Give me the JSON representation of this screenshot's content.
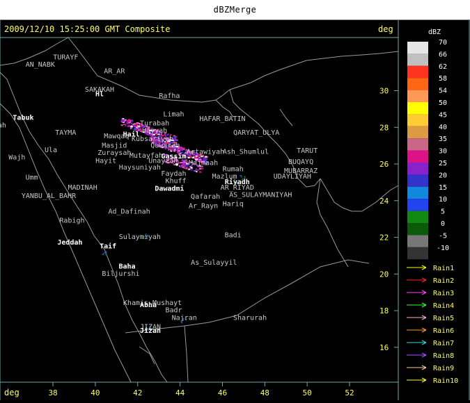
{
  "window": {
    "title": "dBZMerge"
  },
  "header": {
    "timestamp": "2009/12/10 15:25:00 GMT Composite",
    "right_unit": "deg",
    "bottom_unit": "deg"
  },
  "axes": {
    "x_ticks": [
      "38",
      "40",
      "42",
      "44",
      "46",
      "48",
      "50",
      "52"
    ],
    "y_ticks": [
      "30",
      "28",
      "26",
      "24",
      "22",
      "20",
      "18",
      "16"
    ],
    "x_range_deg_lon": [
      35.5,
      54.3
    ],
    "y_range_deg_lat": [
      14.1,
      32.9
    ]
  },
  "colorbar": {
    "title": "dBZ",
    "entries": [
      {
        "label": "70",
        "color": "#e6e6e6"
      },
      {
        "label": "66",
        "color": "#c0c0c0"
      },
      {
        "label": "62",
        "color": "#ff3322"
      },
      {
        "label": "58",
        "color": "#ff6611"
      },
      {
        "label": "54",
        "color": "#ff9955"
      },
      {
        "label": "50",
        "color": "#ffff00"
      },
      {
        "label": "45",
        "color": "#ffcc33"
      },
      {
        "label": "40",
        "color": "#dd9944"
      },
      {
        "label": "35",
        "color": "#cc6688"
      },
      {
        "label": "30",
        "color": "#dd1188"
      },
      {
        "label": "25",
        "color": "#8822cc"
      },
      {
        "label": "20",
        "color": "#3333cc"
      },
      {
        "label": "15",
        "color": "#1188dd"
      },
      {
        "label": "10",
        "color": "#2244ee"
      },
      {
        "label": "5",
        "color": "#118811"
      },
      {
        "label": "0",
        "color": "#0b5a0b"
      },
      {
        "label": "-5",
        "color": "#777777"
      },
      {
        "label": "-10",
        "color": "#333333"
      }
    ]
  },
  "legend": {
    "items": [
      {
        "label": "Rain1",
        "color": "#ffff00"
      },
      {
        "label": "Rain2",
        "color": "#ff2222"
      },
      {
        "label": "Rain3",
        "color": "#ff44ff"
      },
      {
        "label": "Rain4",
        "color": "#33ff33"
      },
      {
        "label": "Rain5",
        "color": "#ffaadd"
      },
      {
        "label": "Rain6",
        "color": "#ff9933"
      },
      {
        "label": "Rain7",
        "color": "#33dddd"
      },
      {
        "label": "Rain8",
        "color": "#aa55ff"
      },
      {
        "label": "Rain9",
        "color": "#ffcc99"
      },
      {
        "label": "Rain10",
        "color": "#ffff33"
      }
    ]
  },
  "places": [
    {
      "name": "TURAYF",
      "lon": 38.6,
      "lat": 31.7
    },
    {
      "name": "AN_NABK",
      "lon": 37.4,
      "lat": 31.3
    },
    {
      "name": "AR_AR",
      "lon": 40.9,
      "lat": 30.95
    },
    {
      "name": "SAKAKAH",
      "lon": 40.2,
      "lat": 29.95
    },
    {
      "name": "Hl",
      "lon": 40.2,
      "lat": 29.7,
      "city": true
    },
    {
      "name": "Rafha",
      "lon": 43.5,
      "lat": 29.6
    },
    {
      "name": "Tabuk",
      "lon": 36.6,
      "lat": 28.4,
      "city": true
    },
    {
      "name": "Sharmah",
      "lon": 35.1,
      "lat": 28.0
    },
    {
      "name": "Limah",
      "lon": 43.7,
      "lat": 28.6
    },
    {
      "name": "HAFAR_BATIN",
      "lon": 46.0,
      "lat": 28.35
    },
    {
      "name": "Turabah",
      "lon": 42.8,
      "lat": 28.1
    },
    {
      "name": "Hayyah",
      "lon": 42.8,
      "lat": 27.7
    },
    {
      "name": "TAYMA",
      "lon": 38.6,
      "lat": 27.6
    },
    {
      "name": "Mawqaq",
      "lon": 41.0,
      "lat": 27.4
    },
    {
      "name": "Hail",
      "lon": 41.7,
      "lat": 27.5,
      "city": true
    },
    {
      "name": "Kubsariyah",
      "lon": 42.7,
      "lat": 27.25
    },
    {
      "name": "QARYAT_ULYA",
      "lon": 47.6,
      "lat": 27.6
    },
    {
      "name": "Masjid",
      "lon": 40.9,
      "lat": 26.9
    },
    {
      "name": "Quwarah",
      "lon": 43.3,
      "lat": 26.9
    },
    {
      "name": "Ula",
      "lon": 37.9,
      "lat": 26.65
    },
    {
      "name": "Artawiyah",
      "lon": 45.2,
      "lat": 26.55
    },
    {
      "name": "Ash_Shumlul",
      "lon": 47.1,
      "lat": 26.55
    },
    {
      "name": "TARUT",
      "lon": 50.0,
      "lat": 26.6
    },
    {
      "name": "Wajh",
      "lon": 36.3,
      "lat": 26.25
    },
    {
      "name": "Zuraysah",
      "lon": 40.9,
      "lat": 26.5
    },
    {
      "name": "Mutayfah",
      "lon": 42.4,
      "lat": 26.35
    },
    {
      "name": "Gassim",
      "lon": 43.7,
      "lat": 26.3,
      "city": true
    },
    {
      "name": "Unayzah",
      "lon": 43.2,
      "lat": 26.05
    },
    {
      "name": "Majmaah",
      "lon": 45.1,
      "lat": 25.95
    },
    {
      "name": "Hayit",
      "lon": 40.5,
      "lat": 26.05
    },
    {
      "name": "Haysuniyah",
      "lon": 42.1,
      "lat": 25.7
    },
    {
      "name": "Rumah",
      "lon": 46.5,
      "lat": 25.6
    },
    {
      "name": "BUQAYQ",
      "lon": 49.7,
      "lat": 26.0
    },
    {
      "name": "MUBARRAZ",
      "lon": 49.7,
      "lat": 25.5
    },
    {
      "name": "Faydah",
      "lon": 43.7,
      "lat": 25.35
    },
    {
      "name": "Mazlum",
      "lon": 46.1,
      "lat": 25.2
    },
    {
      "name": "Riyadh",
      "lon": 46.7,
      "lat": 24.9,
      "city": true
    },
    {
      "name": "UDAYLIYAH",
      "lon": 49.3,
      "lat": 25.2
    },
    {
      "name": "Umm",
      "lon": 37.0,
      "lat": 25.15
    },
    {
      "name": "Khuff",
      "lon": 43.8,
      "lat": 24.95
    },
    {
      "name": "Dawadmi",
      "lon": 43.5,
      "lat": 24.55,
      "city": true
    },
    {
      "name": "AR_RIYAD",
      "lon": 46.7,
      "lat": 24.6
    },
    {
      "name": "MADINAH",
      "lon": 39.4,
      "lat": 24.6
    },
    {
      "name": "AS_SULAYMANIYAH",
      "lon": 47.8,
      "lat": 24.2
    },
    {
      "name": "YANBU_AL_BAHR",
      "lon": 37.8,
      "lat": 24.15
    },
    {
      "name": "Qafarah",
      "lon": 45.2,
      "lat": 24.1
    },
    {
      "name": "Ar_Rayn",
      "lon": 45.1,
      "lat": 23.6
    },
    {
      "name": "Hariq",
      "lon": 46.5,
      "lat": 23.7
    },
    {
      "name": "Ad_Dafinah",
      "lon": 41.6,
      "lat": 23.3
    },
    {
      "name": "Rabigh",
      "lon": 38.9,
      "lat": 22.8
    },
    {
      "name": "Badi",
      "lon": 46.5,
      "lat": 22.0
    },
    {
      "name": "Sulaymiyah",
      "lon": 42.1,
      "lat": 21.9
    },
    {
      "name": "Jeddah",
      "lon": 38.8,
      "lat": 21.6,
      "city": true
    },
    {
      "name": "Taif",
      "lon": 40.6,
      "lat": 21.4,
      "city": true
    },
    {
      "name": "As_Sulayyil",
      "lon": 45.6,
      "lat": 20.5
    },
    {
      "name": "Baha",
      "lon": 41.5,
      "lat": 20.3,
      "city": true
    },
    {
      "name": "Biljurshi",
      "lon": 41.2,
      "lat": 19.9
    },
    {
      "name": "Khamis_Mushayt",
      "lon": 42.7,
      "lat": 18.3
    },
    {
      "name": "Abha",
      "lon": 42.5,
      "lat": 18.2,
      "city": true
    },
    {
      "name": "Badr",
      "lon": 43.7,
      "lat": 17.9
    },
    {
      "name": "Najran",
      "lon": 44.2,
      "lat": 17.5
    },
    {
      "name": "Sharurah",
      "lon": 47.3,
      "lat": 17.5
    },
    {
      "name": "JIZAN",
      "lon": 42.6,
      "lat": 17.0
    },
    {
      "name": "Jizan",
      "lon": 42.6,
      "lat": 16.8,
      "city": true
    }
  ]
}
